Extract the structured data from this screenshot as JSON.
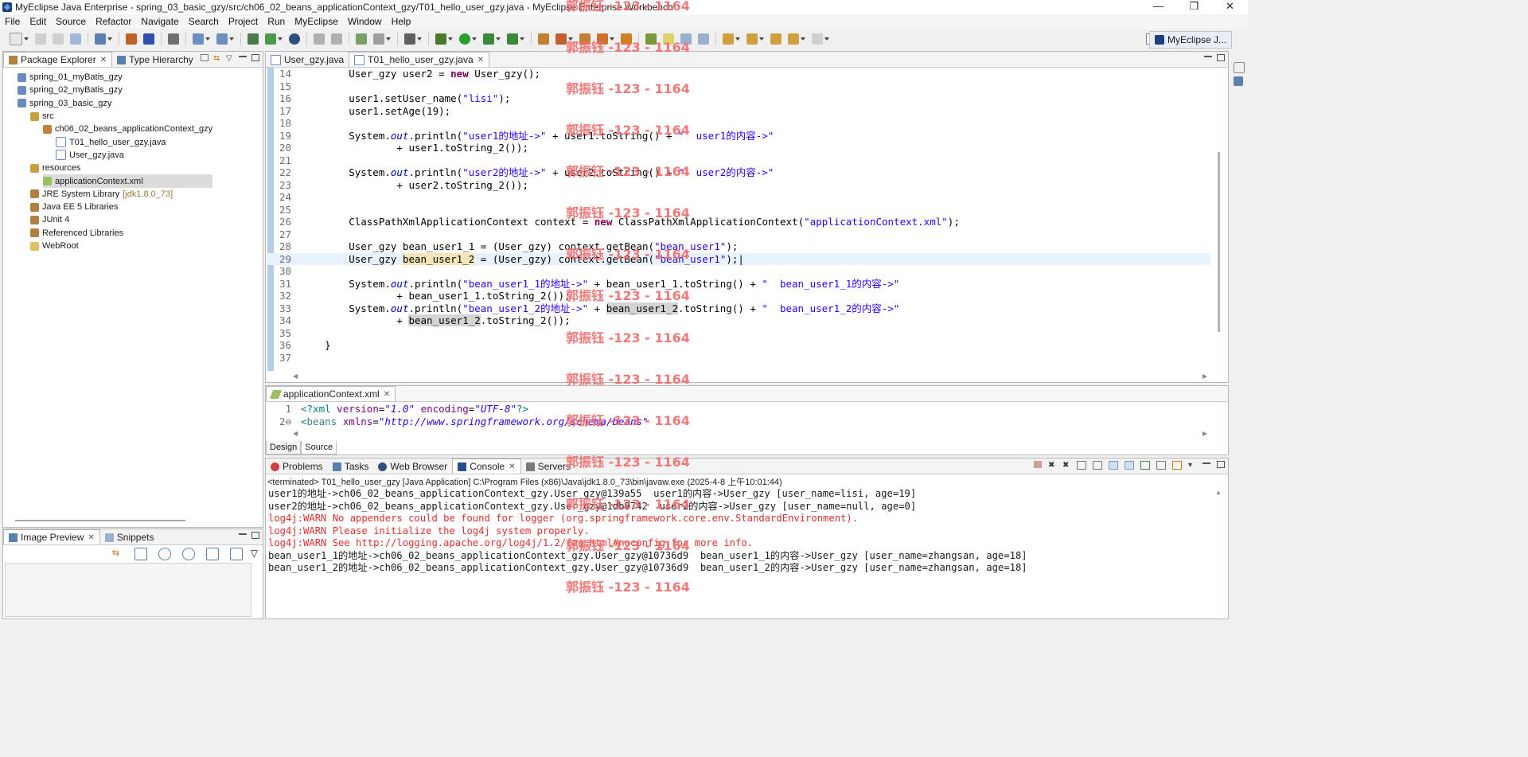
{
  "window": {
    "title": "MyEclipse Java Enterprise - spring_03_basic_gzy/src/ch06_02_beans_applicationContext_gzy/T01_hello_user_gzy.java - MyEclipse Enterprise Workbench",
    "minimize": "—",
    "restore": "❐",
    "close": "✕"
  },
  "menu": [
    "File",
    "Edit",
    "Source",
    "Refactor",
    "Navigate",
    "Search",
    "Project",
    "Run",
    "MyEclipse",
    "Window",
    "Help"
  ],
  "perspective": {
    "label": "MyEclipse J..."
  },
  "package_explorer": {
    "tabs": [
      "Package Explorer",
      "Type Hierarchy"
    ],
    "tree": [
      {
        "label": "spring_01_myBatis_gzy",
        "icon": "project-icon",
        "depth": 0
      },
      {
        "label": "spring_02_myBatis_gzy",
        "icon": "project-icon",
        "depth": 0
      },
      {
        "label": "spring_03_basic_gzy",
        "icon": "project-icon",
        "depth": 0
      },
      {
        "label": "src",
        "icon": "source-folder-icon",
        "depth": 1
      },
      {
        "label": "ch06_02_beans_applicationContext_gzy",
        "icon": "package-icon",
        "depth": 2
      },
      {
        "label": "T01_hello_user_gzy.java",
        "icon": "java-file-icon",
        "depth": 3
      },
      {
        "label": "User_gzy.java",
        "icon": "java-file-icon",
        "depth": 3
      },
      {
        "label": "resources",
        "icon": "source-folder-icon",
        "depth": 1
      },
      {
        "label": "applicationContext.xml",
        "icon": "xml-file-icon",
        "depth": 2,
        "selected": true
      },
      {
        "label": "JRE System Library",
        "decoration": "[jdk1.8.0_73]",
        "icon": "library-icon",
        "depth": 1
      },
      {
        "label": "Java EE 5 Libraries",
        "icon": "library-icon",
        "depth": 1
      },
      {
        "label": "JUnit 4",
        "icon": "library-icon",
        "depth": 1
      },
      {
        "label": "Referenced Libraries",
        "icon": "library-icon",
        "depth": 1
      },
      {
        "label": "WebRoot",
        "icon": "folder-icon",
        "depth": 1
      }
    ]
  },
  "editor": {
    "tabs": [
      "User_gzy.java",
      "T01_hello_user_gzy.java"
    ],
    "active_tab": 1,
    "lines": [
      {
        "n": "14",
        "html": "        User_gzy user2 = <span class=\"kw\">new</span> User_gzy();"
      },
      {
        "n": "15",
        "html": ""
      },
      {
        "n": "16",
        "html": "        user1.setUser_name(<span class=\"str\">\"lisi\"</span>);"
      },
      {
        "n": "17",
        "html": "        user1.setAge(19);"
      },
      {
        "n": "18",
        "html": ""
      },
      {
        "n": "19",
        "html": "        System.<span class=\"fld\">out</span>.println(<span class=\"str\">\"user1的地址-&gt;\"</span> + user1.toString() + <span class=\"str\">\"  user1的内容-&gt;\"</span>"
      },
      {
        "n": "20",
        "html": "                + user1.toString_2());"
      },
      {
        "n": "21",
        "html": ""
      },
      {
        "n": "22",
        "html": "        System.<span class=\"fld\">out</span>.println(<span class=\"str\">\"user2的地址-&gt;\"</span> + user2.toString() + <span class=\"str\">\"  user2的内容-&gt;\"</span>"
      },
      {
        "n": "23",
        "html": "                + user2.toString_2());"
      },
      {
        "n": "24",
        "html": ""
      },
      {
        "n": "25",
        "html": ""
      },
      {
        "n": "26",
        "html": "        ClassPathXmlApplicationContext context = <span class=\"kw\">new</span> ClassPathXmlApplicationContext(<span class=\"str\">\"applicationContext.xml\"</span>);"
      },
      {
        "n": "27",
        "html": ""
      },
      {
        "n": "28",
        "html": "        User_gzy bean_user1_1 = (User_gzy) context.getBean(<span class=\"str\">\"bean_user1\"</span>);"
      },
      {
        "n": "29",
        "html": "        User_gzy <span class=\"hl2\">bean_user1_2</span> = (User_gzy) context.getBean(<span class=\"str\">\"bean_user1\"</span>);|",
        "current": true
      },
      {
        "n": "30",
        "html": ""
      },
      {
        "n": "31",
        "html": "        System.<span class=\"fld\">out</span>.println(<span class=\"str\">\"bean_user1_1的地址-&gt;\"</span> + bean_user1_1.toString() + <span class=\"str\">\"  bean_user1_1的内容-&gt;\"</span>"
      },
      {
        "n": "32",
        "html": "                + bean_user1_1.toString_2());"
      },
      {
        "n": "33",
        "html": "        System.<span class=\"fld\">out</span>.println(<span class=\"str\">\"bean_user1_2的地址-&gt;\"</span> + <span class=\"hl\">bean_user1_2</span>.toString() + <span class=\"str\">\"  bean_user1_2的内容-&gt;\"</span>"
      },
      {
        "n": "34",
        "html": "                + <span class=\"hl\">bean_user1_2</span>.toString_2());"
      },
      {
        "n": "35",
        "html": ""
      },
      {
        "n": "36",
        "html": "    }"
      },
      {
        "n": "37",
        "html": ""
      }
    ]
  },
  "xml_editor": {
    "tab": "applicationContext.xml",
    "lines": [
      {
        "n": "1",
        "html": "<span style=\"color:#008080\">&lt;?xml</span> <span style=\"color:#7f007f\">version</span>=<span class=\"str\" style=\"font-style:italic\">\"1.0\"</span> <span style=\"color:#7f007f\">encoding</span>=<span class=\"str\" style=\"font-style:italic\">\"UTF-8\"</span><span style=\"color:#008080\">?&gt;</span>"
      },
      {
        "n": "2⊖",
        "html": "<span style=\"color:#008080\">&lt;</span><span style=\"color:#3f7f7f\">beans</span> <span style=\"color:#7f007f\">xmlns</span>=<span class=\"str\" style=\"font-style:italic\">\"http://www.springframework.org/schema/beans\"</span>"
      }
    ],
    "bottom_tabs": [
      "Design",
      "Source"
    ]
  },
  "console": {
    "tabs": [
      "Problems",
      "Tasks",
      "Web Browser",
      "Console",
      "Servers"
    ],
    "active_tab": 3,
    "header": "<terminated> T01_hello_user_gzy [Java Application] C:\\Program Files (x86)\\Java\\jdk1.8.0_73\\bin\\javaw.exe (2025-4-8 上午10:01:44)",
    "lines": [
      {
        "text": "user1的地址->ch06_02_beans_applicationContext_gzy.User_gzy@139a55  user1的内容->User_gzy [user_name=lisi, age=19]",
        "err": false
      },
      {
        "text": "user2的地址->ch06_02_beans_applicationContext_gzy.User_gzy@1db9742  user2的内容->User_gzy [user_name=null, age=0]",
        "err": false
      },
      {
        "text": "log4j:WARN No appenders could be found for logger (org.springframework.core.env.StandardEnvironment).",
        "err": true
      },
      {
        "text": "log4j:WARN Please initialize the log4j system properly.",
        "err": true
      },
      {
        "text": "log4j:WARN See http://logging.apache.org/log4j/1.2/faq.html#noconfig for more info.",
        "err": true
      },
      {
        "text": "bean_user1_1的地址->ch06_02_beans_applicationContext_gzy.User_gzy@10736d9  bean_user1_1的内容->User_gzy [user_name=zhangsan, age=18]",
        "err": false
      },
      {
        "text": "bean_user1_2的地址->ch06_02_beans_applicationContext_gzy.User_gzy@10736d9  bean_user1_2的内容->User_gzy [user_name=zhangsan, age=18]",
        "err": false
      }
    ]
  },
  "image_preview": {
    "tabs": [
      "Image Preview",
      "Snippets"
    ]
  },
  "watermark": {
    "text": "郭振钰 -123 - 1164",
    "color": "#f26b6b"
  }
}
